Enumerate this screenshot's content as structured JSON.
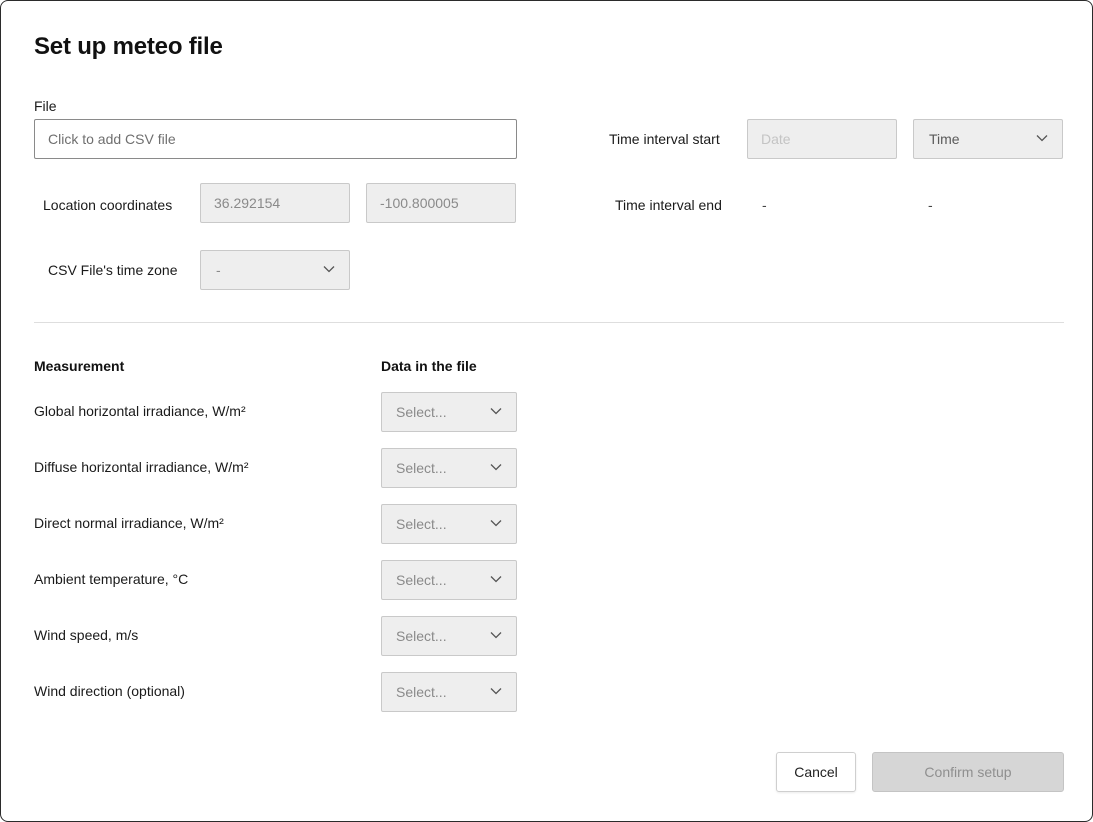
{
  "dialog": {
    "title": "Set up meteo file"
  },
  "file": {
    "label": "File",
    "placeholder": "Click to add CSV file"
  },
  "time_interval_start": {
    "label": "Time interval start",
    "date_placeholder": "Date",
    "time_value": "Time"
  },
  "location": {
    "label": "Location coordinates",
    "latitude": "36.292154",
    "longitude": "-100.800005"
  },
  "time_interval_end": {
    "label": "Time interval end",
    "date_value": "-",
    "time_value": "-"
  },
  "timezone": {
    "label": "CSV File's time zone",
    "value": "-"
  },
  "mapping": {
    "measurement_header": "Measurement",
    "data_header": "Data in the file",
    "rows": [
      {
        "label": "Global horizontal irradiance, W/m²",
        "value": "Select..."
      },
      {
        "label": "Diffuse horizontal irradiance, W/m²",
        "value": "Select..."
      },
      {
        "label": "Direct normal irradiance, W/m²",
        "value": "Select..."
      },
      {
        "label": "Ambient temperature, °C",
        "value": "Select..."
      },
      {
        "label": "Wind speed, m/s",
        "value": "Select..."
      },
      {
        "label": "Wind direction (optional)",
        "value": "Select..."
      }
    ]
  },
  "actions": {
    "cancel": "Cancel",
    "confirm": "Confirm setup"
  },
  "icons": {
    "dropdown": "chevron-down-icon"
  },
  "colors": {
    "disabled_field": "#eeeeee",
    "disabled_button": "#d6d6d6",
    "border": "#c9c9c9"
  }
}
